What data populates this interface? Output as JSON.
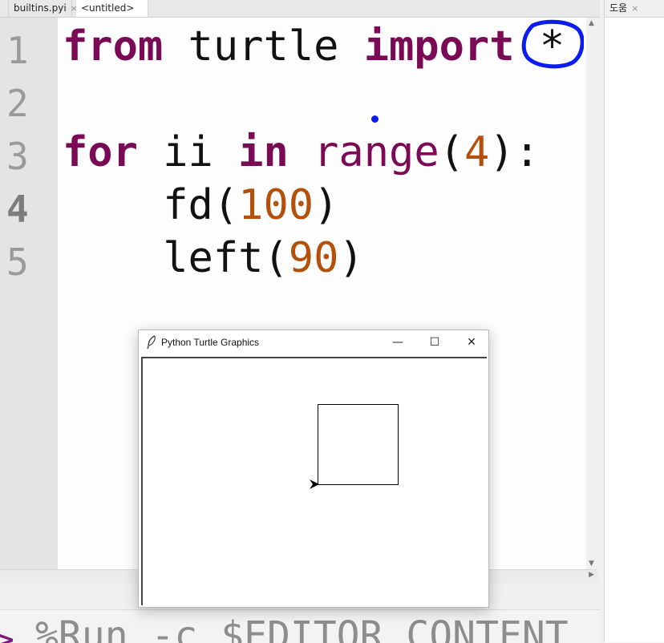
{
  "tabs": [
    {
      "label": "builtins.pyi",
      "close": "×"
    },
    {
      "label": "<untitled> *",
      "close": "×"
    }
  ],
  "right_panel": {
    "tab_label": "도움",
    "close": "×"
  },
  "editor": {
    "line_numbers": [
      "1",
      "2",
      "3",
      "4",
      "5"
    ],
    "lines": [
      [
        {
          "t": "from",
          "c": "kw"
        },
        {
          "t": " turtle ",
          "c": ""
        },
        {
          "t": "import",
          "c": "kw"
        },
        {
          "t": " *",
          "c": ""
        }
      ],
      [],
      [
        {
          "t": "for",
          "c": "kw"
        },
        {
          "t": " ii ",
          "c": ""
        },
        {
          "t": "in",
          "c": "kw"
        },
        {
          "t": " ",
          "c": ""
        },
        {
          "t": "range",
          "c": "bi"
        },
        {
          "t": "(",
          "c": ""
        },
        {
          "t": "4",
          "c": "num"
        },
        {
          "t": "):",
          "c": ""
        }
      ],
      [
        {
          "t": "    fd(",
          "c": ""
        },
        {
          "t": "100",
          "c": "num"
        },
        {
          "t": ")",
          "c": ""
        }
      ],
      [
        {
          "t": "    left(",
          "c": ""
        },
        {
          "t": "90",
          "c": "num"
        },
        {
          "t": ")",
          "c": ""
        }
      ]
    ]
  },
  "shell": {
    "command": "%Run -c $EDITOR_CONTENT"
  },
  "turtle_window": {
    "title": "Python Turtle Graphics",
    "minimize": "—",
    "maximize": "☐",
    "close": "✕"
  },
  "colors": {
    "keyword": "#7a0a55",
    "number": "#b4500c",
    "annotation": "#0a1cf0"
  }
}
